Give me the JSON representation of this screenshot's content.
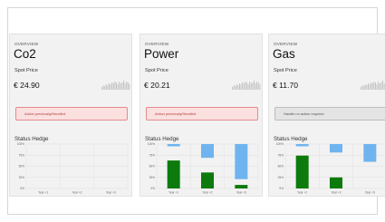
{
  "cards": [
    {
      "overview": "OVERVIEW",
      "title": "Co2",
      "spot_label": "Spot Price",
      "price": "€ 24.90",
      "status_text": "Action previously/Handled",
      "status_type": "red",
      "status_hedge_label": "Status Hedge",
      "hedge": {
        "y_ticks": [
          "100%",
          "75%",
          "50%",
          "25%",
          "0%"
        ],
        "categories": [
          "Year +1",
          "Year +2",
          "Year +3"
        ],
        "hedged": [
          0,
          0,
          0
        ],
        "open": [
          0,
          0,
          0
        ]
      }
    },
    {
      "overview": "OVERVIEW",
      "title": "Power",
      "spot_label": "Spot Price",
      "price": "€ 20.21",
      "status_text": "Action previously/Handled",
      "status_type": "red",
      "status_hedge_label": "Status Hedge",
      "hedge": {
        "y_ticks": [
          "100%",
          "75%",
          "50%",
          "25%",
          "0%"
        ],
        "categories": [
          "Year +1",
          "Year +2",
          "Year +3"
        ],
        "hedged": [
          63,
          36,
          8
        ],
        "open": [
          5,
          31,
          79
        ]
      }
    },
    {
      "overview": "OVERVIEW",
      "title": "Gas",
      "spot_label": "Spot Price",
      "price": "€ 11.70",
      "status_text": "Handle no action required",
      "status_type": "gray",
      "status_hedge_label": "Status Hedge",
      "hedge": {
        "y_ticks": [
          "100%",
          "75%",
          "50%",
          "25%",
          "0%"
        ],
        "categories": [
          "Year +1",
          "Year +2",
          "Year +3"
        ],
        "hedged": [
          74,
          25,
          0
        ],
        "open": [
          5,
          19,
          40
        ]
      }
    }
  ],
  "colors": {
    "hedged": "#0c7a0c",
    "open": "#6fb4ef",
    "grid": "#dddddd",
    "spark": "#c4c4c4"
  }
}
